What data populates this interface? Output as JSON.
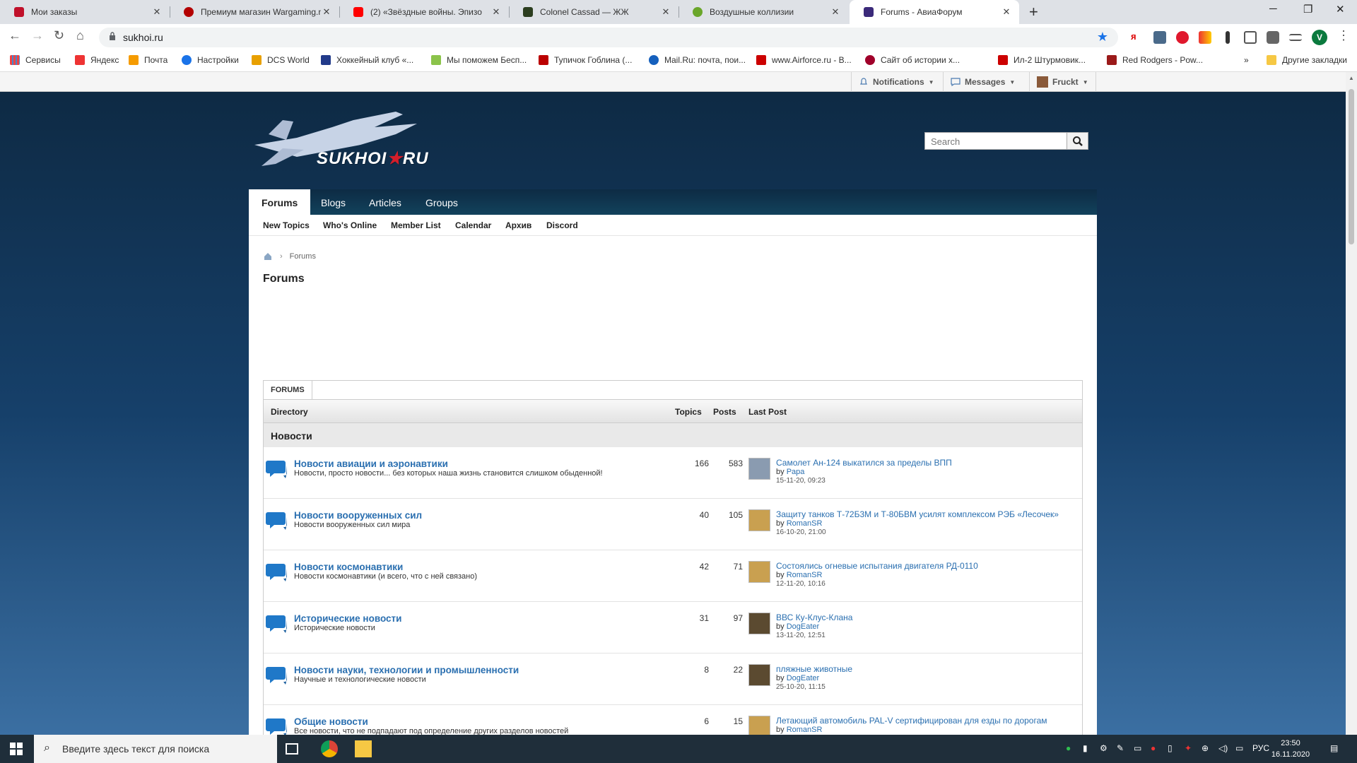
{
  "browser": {
    "tabs": [
      {
        "title": "Мои заказы",
        "color": "#c0102a"
      },
      {
        "title": "Премиум магазин Wargaming.n",
        "color": "#b30000"
      },
      {
        "title": "(2) «Звёздные войны. Эпизо",
        "color": "#ff0000"
      },
      {
        "title": "Colonel Cassad — ЖЖ",
        "color": "#2c3e1f"
      },
      {
        "title": "Воздушные коллизии",
        "color": "#6aa62a"
      },
      {
        "title": "Forums - АвиаФорум",
        "color": "#3b2a7a"
      }
    ],
    "new_tab": "+",
    "window_controls": {
      "minimize": "─",
      "maximize": "❐",
      "close": "✕"
    },
    "url": "sukhoi.ru",
    "profile_initial": "V",
    "bookmarks": [
      "Сервисы",
      "Яндекс",
      "Почта",
      "Настройки",
      "DCS World",
      "Хоккейный клуб «...",
      "Мы поможем Бесп...",
      "Тупичок Гоблина (...",
      "Mail.Ru: почта, пои...",
      "www.Airforce.ru - В...",
      "Сайт об истории х...",
      "Ил-2 Штурмовик...",
      "Red Rodgers - Pow..."
    ],
    "bookmarks_more": "»",
    "other_bookmarks": "Другие закладки"
  },
  "forum_top": {
    "notifications": "Notifications",
    "messages": "Messages",
    "user": "Fruckt"
  },
  "site": {
    "logo_text": "SUKHOI",
    "logo_star": "★",
    "logo_tld": "RU",
    "search_placeholder": "Search"
  },
  "nav": {
    "tabs": [
      "Forums",
      "Blogs",
      "Articles",
      "Groups"
    ],
    "sub": [
      "New Topics",
      "Who's Online",
      "Member List",
      "Calendar",
      "Архив",
      "Discord"
    ]
  },
  "page": {
    "breadcrumb": "Forums",
    "title": "Forums"
  },
  "widget": {
    "tab": "FORUMS",
    "columns": {
      "directory": "Directory",
      "topics": "Topics",
      "posts": "Posts",
      "last_post": "Last Post"
    },
    "category": "Новости",
    "forums": [
      {
        "name": "Новости авиации и аэронавтики",
        "desc": "Новости, просто новости... без которых наша жизнь становится слишком обыденной!",
        "topics": "166",
        "posts": "583",
        "last_title": "Самолет Ан-124 выкатился за пределы ВПП",
        "by_label": "by",
        "last_by": "Papa",
        "last_date": "15-11-20, 09:23",
        "avatar": "#8a9bb0"
      },
      {
        "name": "Новости вооруженных сил",
        "desc": "Новости вооруженных сил мира",
        "topics": "40",
        "posts": "105",
        "last_title": "Защиту танков Т-72Б3М и Т-80БВМ усилят комплексом РЭБ «Лесочек»",
        "by_label": "by",
        "last_by": "RomanSR",
        "last_date": "16-10-20, 21:00",
        "avatar": "#c9a050"
      },
      {
        "name": "Новости космонавтики",
        "desc": "Новости космонавтики (и всего, что с ней связано)",
        "topics": "42",
        "posts": "71",
        "last_title": "Состоялись огневые испытания двигателя РД-0110",
        "by_label": "by",
        "last_by": "RomanSR",
        "last_date": "12-11-20, 10:16",
        "avatar": "#c9a050"
      },
      {
        "name": "Исторические новости",
        "desc": "Исторические новости",
        "topics": "31",
        "posts": "97",
        "last_title": "ВВС Ку-Клус-Клана",
        "by_label": "by",
        "last_by": "DogEater",
        "last_date": "13-11-20, 12:51",
        "avatar": "#5b4a30"
      },
      {
        "name": "Новости науки, технологии и промышленности",
        "desc": "Научные и технологические новости",
        "topics": "8",
        "posts": "22",
        "last_title": "пляжные животные",
        "by_label": "by",
        "last_by": "DogEater",
        "last_date": "25-10-20, 11:15",
        "avatar": "#5b4a30"
      },
      {
        "name": "Общие новости",
        "desc": "Все новости, что не подпадают под определение других разделов новостей",
        "topics": "6",
        "posts": "15",
        "last_title": "Летающий автомобиль PAL-V сертифицирован для езды по дорогам",
        "by_label": "by",
        "last_by": "RomanSR",
        "last_date": "",
        "avatar": "#c9a050"
      }
    ]
  },
  "taskbar": {
    "search_text": "Введите здесь текст для поиска",
    "lang": "РУС",
    "time": "23:50",
    "date": "16.11.2020"
  }
}
